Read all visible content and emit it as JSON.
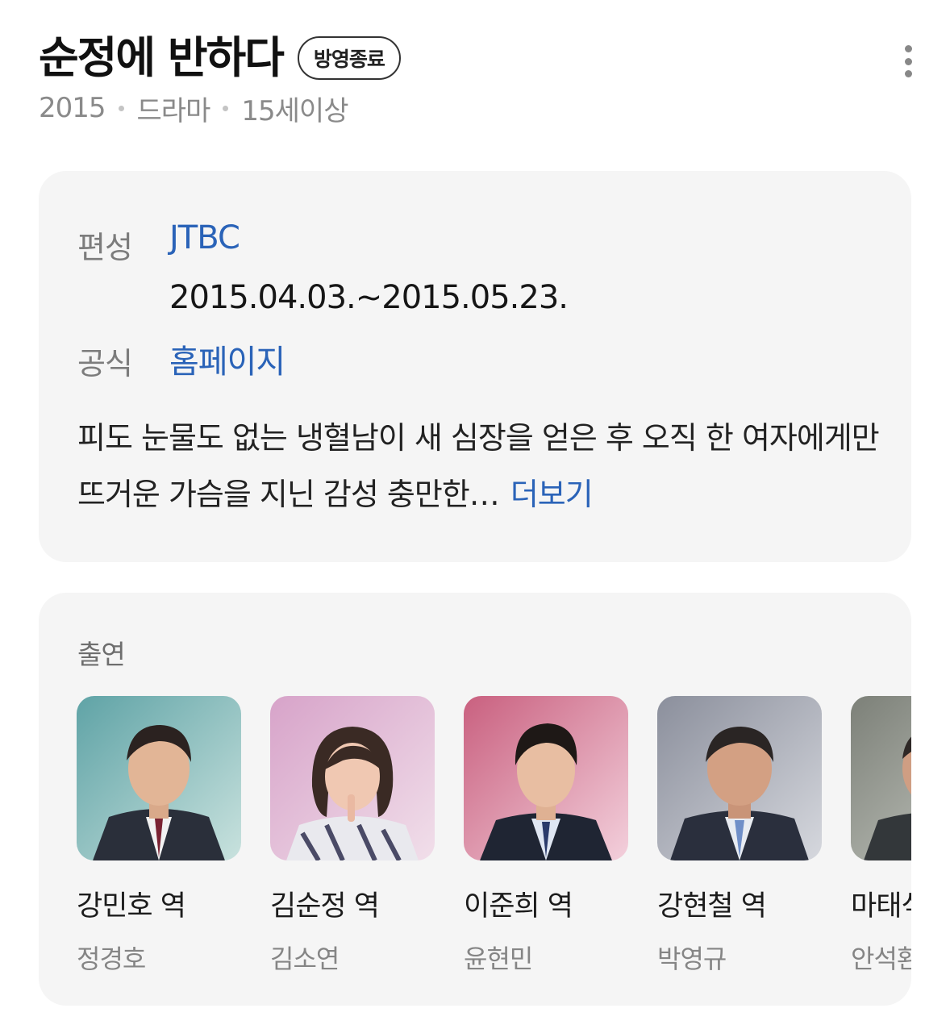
{
  "header": {
    "title": "순정에 반하다",
    "status_badge": "방영종료",
    "meta": [
      "2015",
      "드라마",
      "15세이상"
    ],
    "more_icon": "more-vertical-icon"
  },
  "info": {
    "broadcast_label": "편성",
    "broadcast_channel": "JTBC",
    "broadcast_period": "2015.04.03.~2015.05.23.",
    "official_label": "공식",
    "official_link": "홈페이지",
    "synopsis": "피도 눈물도 없는 냉혈남이 새 심장을 얻은 후 오직 한 여자에게만 뜨거운 가슴을 지닌 감성 충만한…",
    "more_label": "더보기",
    "link_color": "#2a63b8"
  },
  "cast": {
    "heading": "출연",
    "items": [
      {
        "role": "강민호 역",
        "actor": "정경호"
      },
      {
        "role": "김순정 역",
        "actor": "김소연"
      },
      {
        "role": "이준희 역",
        "actor": "윤현민"
      },
      {
        "role": "강현철 역",
        "actor": "박영규"
      },
      {
        "role": "마태식 역",
        "actor": "안석환"
      }
    ]
  }
}
